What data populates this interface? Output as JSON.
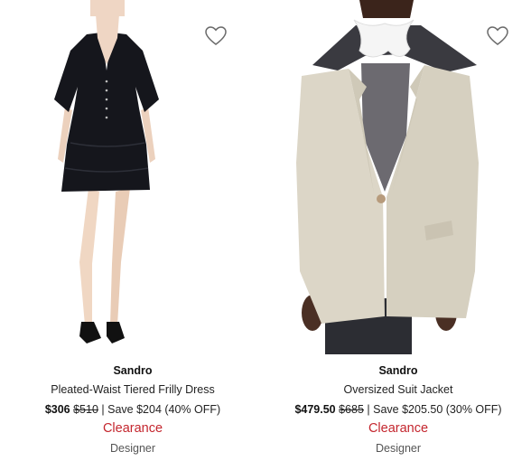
{
  "products": [
    {
      "brand": "Sandro",
      "name": "Pleated-Waist Tiered Frilly Dress",
      "price_now": "$306",
      "price_was": "$510",
      "savings": "| Save $204 (40% OFF)",
      "badge": "Clearance",
      "category": "Designer",
      "image": "black-dress-photo"
    },
    {
      "brand": "Sandro",
      "name": "Oversized Suit Jacket",
      "price_now": "$479.50",
      "price_was": "$685",
      "savings": "| Save $205.50 (30% OFF)",
      "badge": "Clearance",
      "category": "Designer",
      "image": "beige-jacket-photo"
    }
  ],
  "icons": {
    "favorite": "heart-outline-icon"
  },
  "colors": {
    "clearance": "#c4262e",
    "text": "#222222"
  }
}
